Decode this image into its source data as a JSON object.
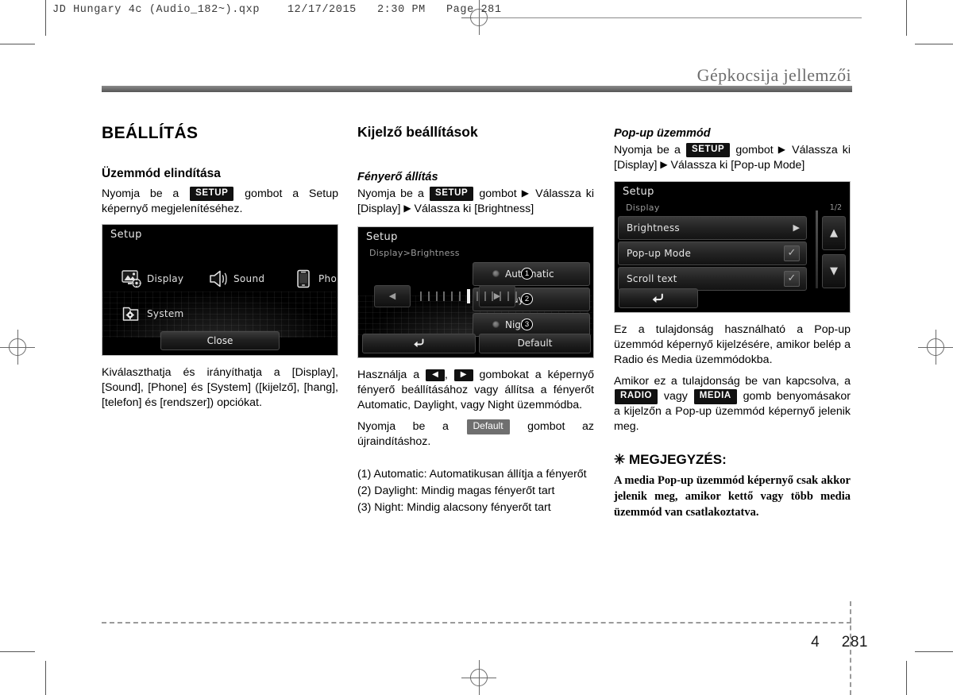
{
  "prepress": {
    "header": "JD Hungary 4c (Audio_182~).qxp    12/17/2015   2:30 PM   Page 281"
  },
  "running_head": "Gépkocsija jellemzői",
  "footer": {
    "chapter": "4",
    "page": "281"
  },
  "col1": {
    "section_title": "BEÁLLÍTÁS",
    "sub_title": "Üzemmód elindítása",
    "intro_pre": "Nyomja be a",
    "intro_chip": "SETUP",
    "intro_post": "gombot a Setup képernyő megjelenítéséhez.",
    "screen": {
      "title": "Setup",
      "items": [
        {
          "label": "Display",
          "icon": "display-icon"
        },
        {
          "label": "Sound",
          "icon": "speaker-icon"
        },
        {
          "label": "Phone",
          "icon": "phone-icon"
        },
        {
          "label": "System",
          "icon": "folder-gear-icon"
        }
      ],
      "close_label": "Close"
    },
    "caption": "Kiválaszthatja és irányíthatja a [Display], [Sound], [Phone] és [System] ([kijelző], [hang], [telefon] és [rendszer]) opciókat."
  },
  "col2": {
    "section_title": "Kijelző beállítások",
    "sub_title": "Fényerő állítás",
    "path_pre": "Nyomja be a",
    "path_chip": "SETUP",
    "path_mid": "gombot",
    "path_post": "Válassza ki [Display]",
    "path_post2": "Válassza ki [Brightness]",
    "screen": {
      "title": "Setup",
      "breadcrumb": "Display>Brightness",
      "options": [
        {
          "num": "1",
          "label": "Automatic"
        },
        {
          "num": "2",
          "label": "Day"
        },
        {
          "num": "3",
          "label": "Night"
        }
      ],
      "left_arrow": "◀",
      "right_arrow": "▶",
      "back_icon": "back-arrow-icon",
      "default_label": "Default"
    },
    "para1_pre": "Használja a",
    "para1_mid": ",",
    "para1_post": "gombokat a képernyő fényerő beállításához vagy állítsa a fényerőt Automatic, Daylight, vagy Night üzemmódba.",
    "para2_pre": "Nyomja be a",
    "para2_chip": "Default",
    "para2_post": "gombot az újraindításhoz.",
    "numbered_items": [
      "(1) Automatic: Automatikusan állítja a fényerőt",
      "(2) Daylight: Mindig magas fényerőt tart",
      "(3) Night: Mindig alacsony fényerőt tart"
    ]
  },
  "col3": {
    "sub_title": "Pop-up üzemmód",
    "path_pre": "Nyomja be a",
    "path_chip": "SETUP",
    "path_mid": "gombot",
    "path_post": "Válassza ki [Display]",
    "path_post2": "Válassza ki [Pop-up Mode]",
    "screen": {
      "title": "Setup",
      "breadcrumb": "Display",
      "page_indicator": "1/2",
      "rows": [
        {
          "label": "Brightness",
          "control": "arrow"
        },
        {
          "label": "Pop-up Mode",
          "control": "check"
        },
        {
          "label": "Scroll text",
          "control": "check"
        }
      ],
      "up_icon": "▲",
      "down_icon": "▼",
      "back_icon": "back-arrow-icon"
    },
    "para1": "Ez a tulajdonság használható a Pop-up üzemmód képernyő kijelzésére, amikor belép a Radio és Media üzemmódokba.",
    "para2_pre": "Amikor ez a tulajdonság be van kapcsolva, a",
    "para2_chip1": "RADIO",
    "para2_mid": "vagy",
    "para2_chip2": "MEDIA",
    "para2_post": "gomb benyomásakor a kijelzőn a Pop-up üzemmód képernyő jelenik meg.",
    "note_title": "✳ MEGJEGYZÉS:",
    "note_body": "A media Pop-up üzemmód képernyő csak akkor jelenik meg, amikor kettő vagy több media üzemmód van csatlakoztatva."
  }
}
